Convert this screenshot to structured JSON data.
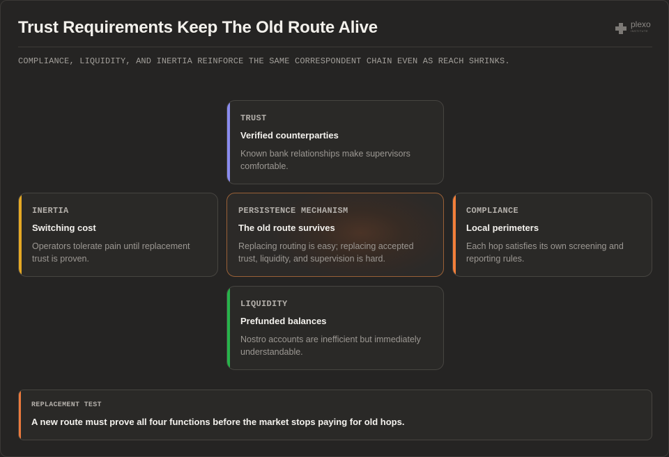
{
  "header": {
    "title": "Trust Requirements Keep The Old Route Alive",
    "subtitle": "COMPLIANCE, LIQUIDITY, AND INERTIA REINFORCE THE SAME CORRESPONDENT CHAIN EVEN AS REACH SHRINKS."
  },
  "logo": {
    "name": "plexo",
    "tagline": "INSTITUTE",
    "icon": "plus-icon"
  },
  "colors": {
    "trust": "#8a8cf0",
    "inertia": "#e5a824",
    "compliance": "#f37f3a",
    "liquidity": "#27b44a",
    "mechanism_border": "#9a6137",
    "replacement": "#ec7a3c"
  },
  "cards": {
    "trust": {
      "label": "TRUST",
      "heading": "Verified counterparties",
      "body": "Known bank relationships make supervisors comfortable."
    },
    "inertia": {
      "label": "INERTIA",
      "heading": "Switching cost",
      "body": "Operators tolerate pain until replacement trust is proven."
    },
    "mechanism": {
      "label": "PERSISTENCE MECHANISM",
      "heading": "The old route survives",
      "body": "Replacing routing is easy; replacing accepted trust, liquidity, and supervision is hard."
    },
    "compliance": {
      "label": "COMPLIANCE",
      "heading": "Local perimeters",
      "body": "Each hop satisfies its own screening and reporting rules."
    },
    "liquidity": {
      "label": "LIQUIDITY",
      "heading": "Prefunded balances",
      "body": "Nostro accounts are inefficient but immediately understandable."
    }
  },
  "footer": {
    "label": "REPLACEMENT TEST",
    "text": "A new route must prove all four functions before the market stops paying for old hops."
  }
}
